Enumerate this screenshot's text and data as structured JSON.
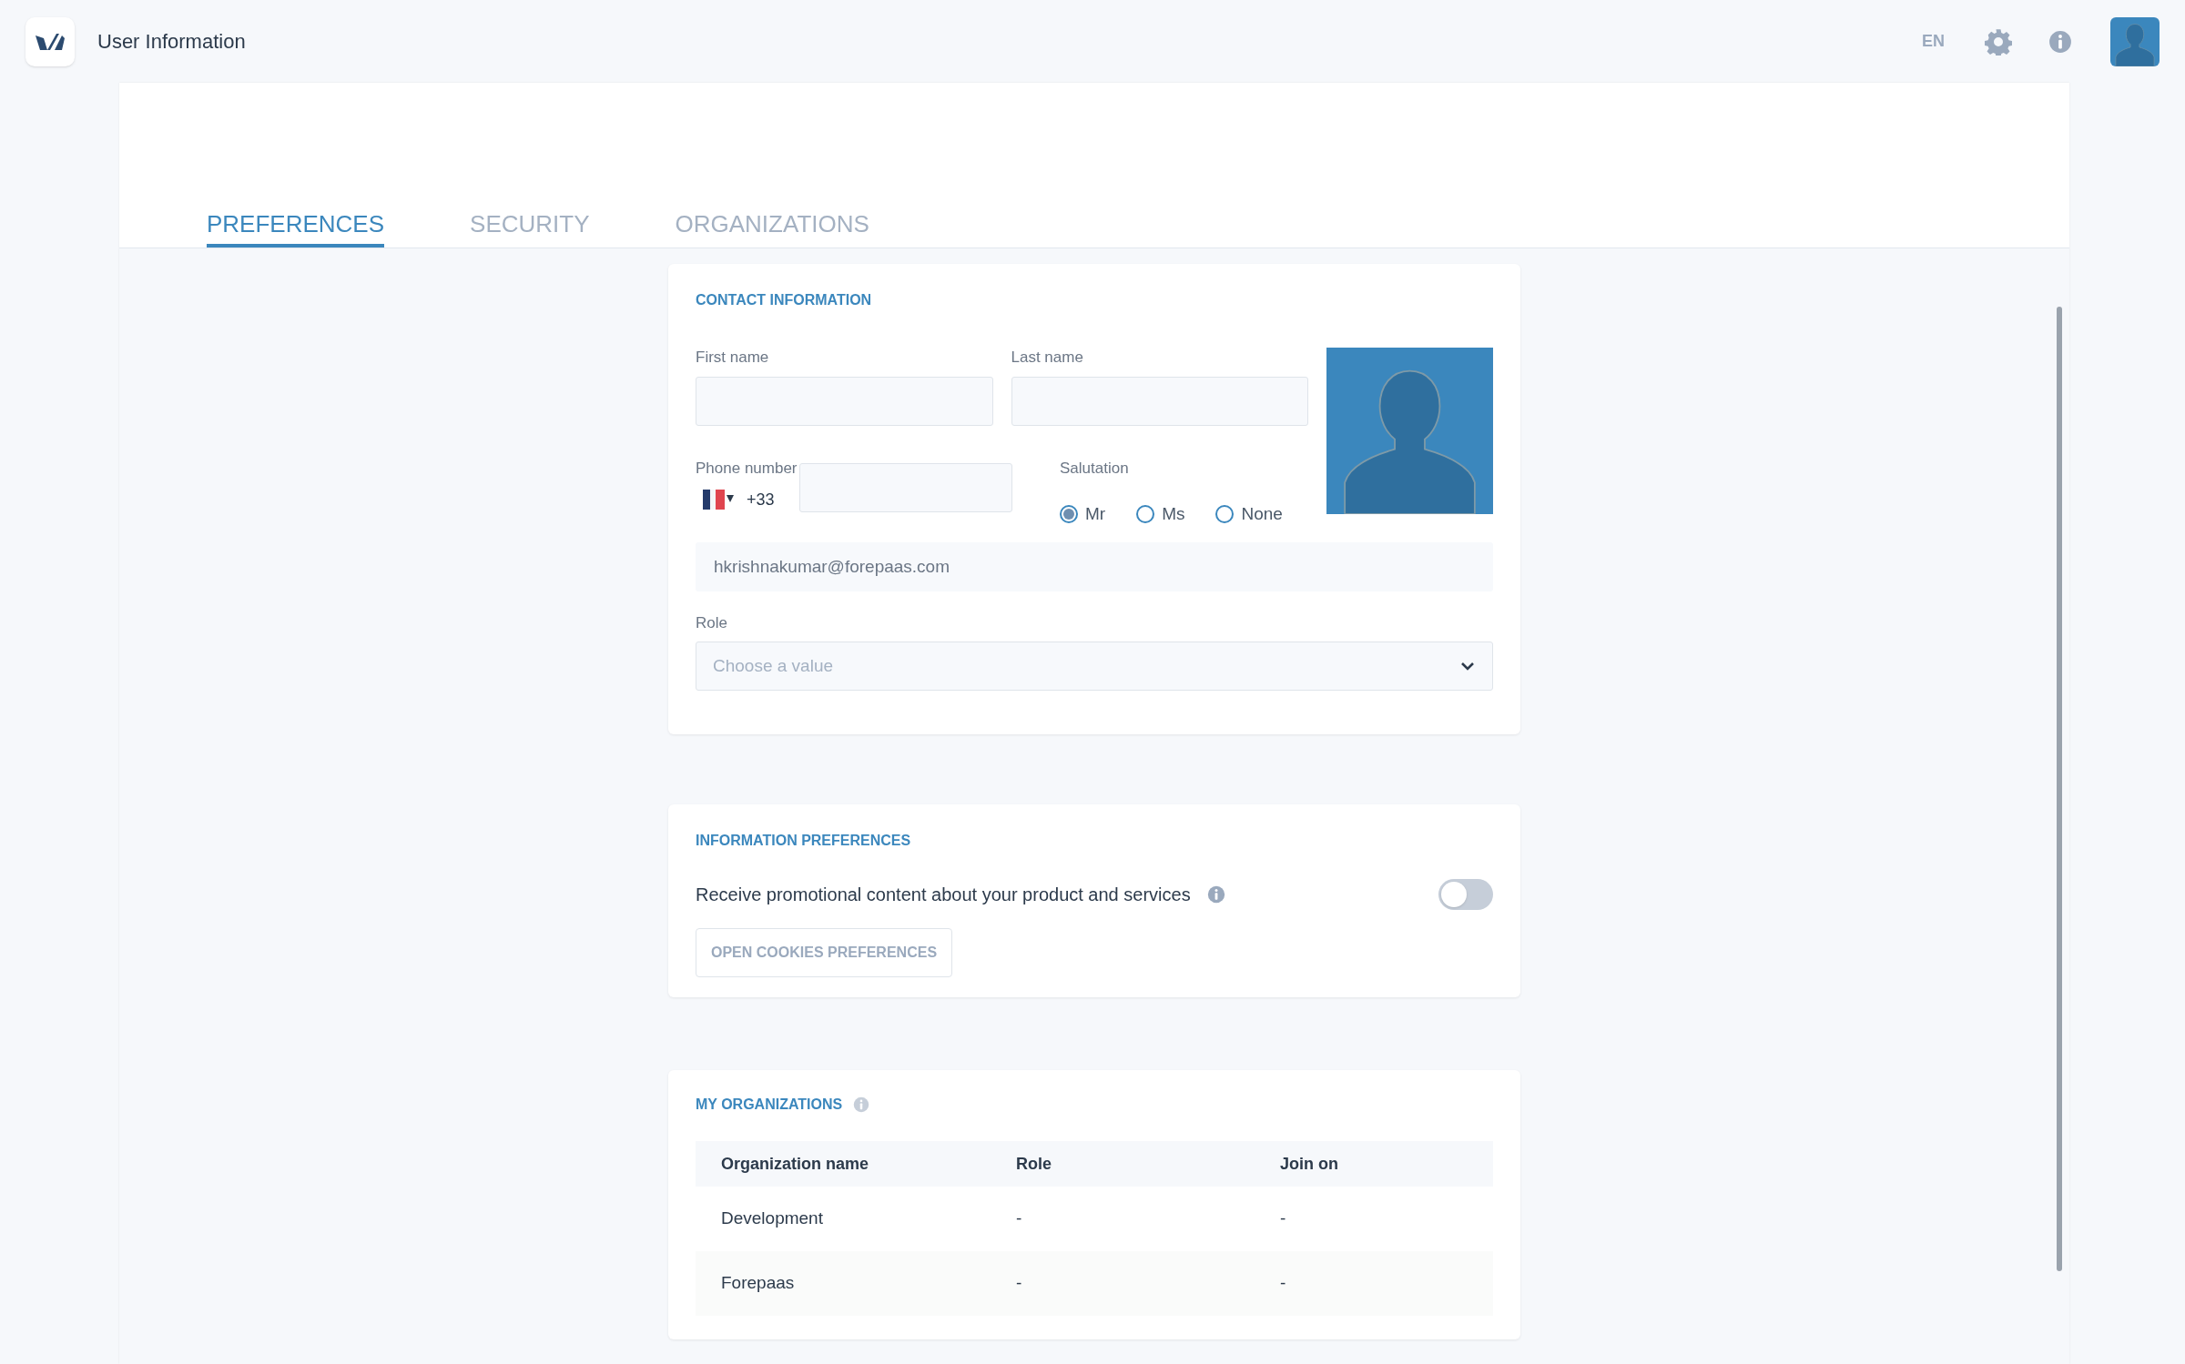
{
  "header": {
    "title": "User Information",
    "language": "EN"
  },
  "tabs": [
    {
      "label": "PREFERENCES",
      "selected": true
    },
    {
      "label": "SECURITY",
      "selected": false
    },
    {
      "label": "ORGANIZATIONS",
      "selected": false
    }
  ],
  "contact": {
    "title": "CONTACT INFORMATION",
    "first_name": {
      "label": "First name"
    },
    "last_name": {
      "label": "Last name"
    },
    "phone": {
      "label": "Phone number",
      "code": "+33"
    },
    "salutation": {
      "label": "Salutation",
      "options": [
        {
          "label": "Mr",
          "selected": true
        },
        {
          "label": "Ms",
          "selected": false
        },
        {
          "label": "None",
          "selected": false
        }
      ]
    },
    "email": {
      "value": "hkrishnakumar@forepaas.com"
    },
    "role": {
      "label": "Role",
      "placeholder": "Choose a value"
    }
  },
  "preferences": {
    "title": "INFORMATION PREFERENCES",
    "promo": {
      "label": "Receive promotional content about your product and services",
      "on": false
    },
    "button": "OPEN COOKIES PREFERENCES"
  },
  "organizations": {
    "title": "MY ORGANIZATIONS",
    "columns": [
      "Organization name",
      "Role",
      "Join on"
    ],
    "rows": [
      [
        "Development",
        "-",
        "-"
      ],
      [
        "Forepaas",
        "-",
        "-"
      ]
    ]
  }
}
